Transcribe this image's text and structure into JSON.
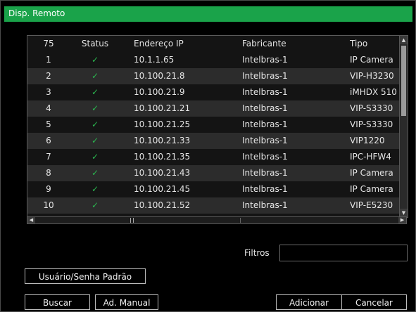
{
  "window": {
    "title": "Disp. Remoto"
  },
  "table": {
    "columns": [
      "75",
      "Status",
      "Endereço IP",
      "Fabricante",
      "Tipo"
    ],
    "rows": [
      {
        "no": "1",
        "status": "✓",
        "ip": "10.1.1.65",
        "fabricante": "Intelbras-1",
        "tipo": "IP Camera"
      },
      {
        "no": "2",
        "status": "✓",
        "ip": "10.100.21.8",
        "fabricante": "Intelbras-1",
        "tipo": "VIP-H3230"
      },
      {
        "no": "3",
        "status": "✓",
        "ip": "10.100.21.9",
        "fabricante": "Intelbras-1",
        "tipo": "iMHDX 510"
      },
      {
        "no": "4",
        "status": "✓",
        "ip": "10.100.21.21",
        "fabricante": "Intelbras-1",
        "tipo": "VIP-S3330"
      },
      {
        "no": "5",
        "status": "✓",
        "ip": "10.100.21.25",
        "fabricante": "Intelbras-1",
        "tipo": "VIP-S3330"
      },
      {
        "no": "6",
        "status": "✓",
        "ip": "10.100.21.33",
        "fabricante": "Intelbras-1",
        "tipo": "VIP1220"
      },
      {
        "no": "7",
        "status": "✓",
        "ip": "10.100.21.35",
        "fabricante": "Intelbras-1",
        "tipo": "IPC-HFW4"
      },
      {
        "no": "8",
        "status": "✓",
        "ip": "10.100.21.43",
        "fabricante": "Intelbras-1",
        "tipo": "IP Camera"
      },
      {
        "no": "9",
        "status": "✓",
        "ip": "10.100.21.45",
        "fabricante": "Intelbras-1",
        "tipo": "IP Camera"
      },
      {
        "no": "10",
        "status": "✓",
        "ip": "10.100.21.52",
        "fabricante": "Intelbras-1",
        "tipo": "VIP-E5230"
      }
    ]
  },
  "filters": {
    "label": "Filtros",
    "value": ""
  },
  "buttons": {
    "default_credentials": "Usuário/Senha Padrão",
    "search": "Buscar",
    "manual_add": "Ad. Manual",
    "add": "Adicionar",
    "cancel": "Cancelar"
  },
  "scrollbar_icons": {
    "up": "arrow-up-icon",
    "down": "arrow-down-icon",
    "left": "arrow-left-icon",
    "right": "arrow-right-icon"
  },
  "colors": {
    "title_bar": "#1aa34a",
    "status_ok": "#2ab54f"
  }
}
